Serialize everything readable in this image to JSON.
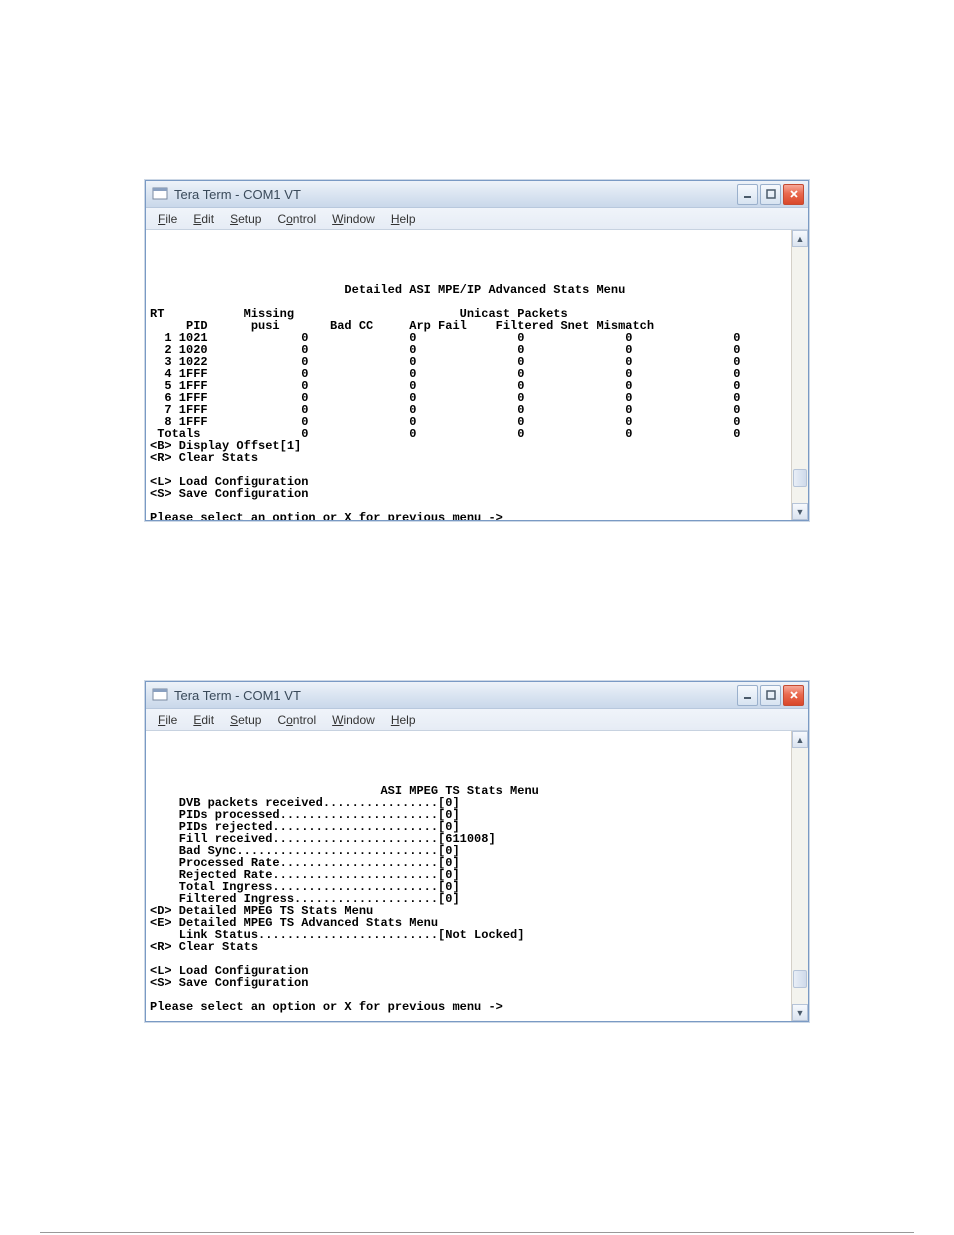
{
  "window": {
    "title": "Tera Term - COM1 VT",
    "menus": [
      "File",
      "Edit",
      "Setup",
      "Control",
      "Window",
      "Help"
    ]
  },
  "screen1": {
    "title": "Detailed ASI MPE/IP Advanced Stats Menu",
    "grp_label_rt": "RT",
    "grp_label_unicast": "Unicast Packets",
    "cols": {
      "pid": "PID",
      "missing_pusi": "Missing\npusi",
      "bad_cc": "Bad CC",
      "arp_fail": "Arp Fail",
      "filtered": "Filtered",
      "snet_mismatch": "Snet Mismatch"
    },
    "rows": [
      {
        "n": "1",
        "pid": "1021",
        "missing": "0",
        "bad": "0",
        "arp": "0",
        "filt": "0",
        "snet": "0"
      },
      {
        "n": "2",
        "pid": "1020",
        "missing": "0",
        "bad": "0",
        "arp": "0",
        "filt": "0",
        "snet": "0"
      },
      {
        "n": "3",
        "pid": "1022",
        "missing": "0",
        "bad": "0",
        "arp": "0",
        "filt": "0",
        "snet": "0"
      },
      {
        "n": "4",
        "pid": "1FFF",
        "missing": "0",
        "bad": "0",
        "arp": "0",
        "filt": "0",
        "snet": "0"
      },
      {
        "n": "5",
        "pid": "1FFF",
        "missing": "0",
        "bad": "0",
        "arp": "0",
        "filt": "0",
        "snet": "0"
      },
      {
        "n": "6",
        "pid": "1FFF",
        "missing": "0",
        "bad": "0",
        "arp": "0",
        "filt": "0",
        "snet": "0"
      },
      {
        "n": "7",
        "pid": "1FFF",
        "missing": "0",
        "bad": "0",
        "arp": "0",
        "filt": "0",
        "snet": "0"
      },
      {
        "n": "8",
        "pid": "1FFF",
        "missing": "0",
        "bad": "0",
        "arp": "0",
        "filt": "0",
        "snet": "0"
      }
    ],
    "totals": {
      "label": "Totals",
      "missing": "0",
      "bad": "0",
      "arp": "0",
      "filt": "0",
      "snet": "0"
    },
    "opt_b": "<B> Display Offset[1]",
    "opt_r": "<R> Clear Stats",
    "opt_l": "<L> Load Configuration",
    "opt_s": "<S> Save Configuration",
    "prompt": "Please select an option or X for previous menu ->"
  },
  "screen2": {
    "title": "ASI MPEG TS Stats Menu",
    "lines": [
      {
        "label": "DVB packets received",
        "val": "0"
      },
      {
        "label": "PIDs processed",
        "val": "0"
      },
      {
        "label": "PIDs rejected",
        "val": "0"
      },
      {
        "label": "Fill received",
        "val": "611008"
      },
      {
        "label": "Bad Sync",
        "val": "0"
      },
      {
        "label": "Processed Rate",
        "val": "0"
      },
      {
        "label": "Rejected Rate",
        "val": "0"
      },
      {
        "label": "Total Ingress",
        "val": "0"
      },
      {
        "label": "Filtered Ingress",
        "val": "0"
      }
    ],
    "opt_d": "<D> Detailed MPEG TS Stats Menu",
    "opt_e": "<E> Detailed MPEG TS Advanced Stats Menu",
    "link_status": {
      "label": "Link Status",
      "val": "Not Locked"
    },
    "opt_r": "<R> Clear Stats",
    "opt_l": "<L> Load Configuration",
    "opt_s": "<S> Save Configuration",
    "prompt": "Please select an option or X for previous menu ->"
  }
}
